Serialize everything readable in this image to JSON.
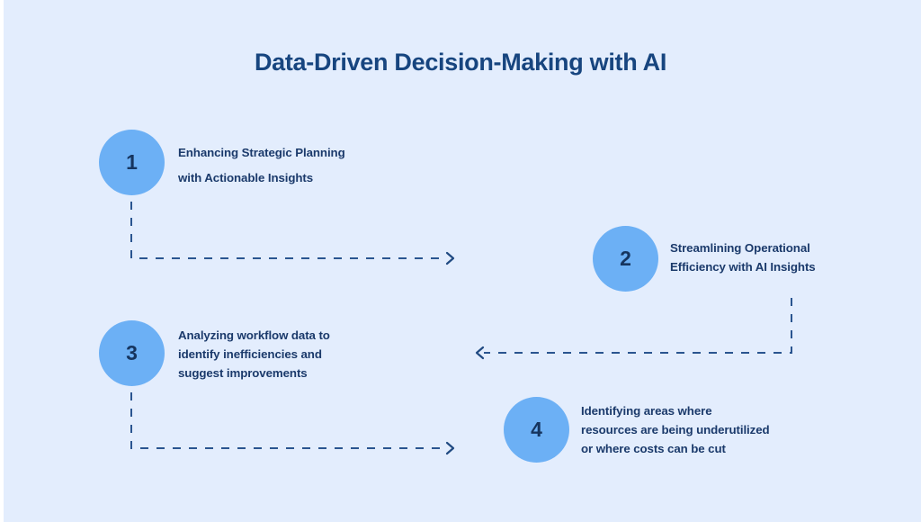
{
  "page": {
    "title": "Data-Driven Decision-Making with AI",
    "background_color": "#e3edfd",
    "title_color": "#17457f",
    "circle_color": "#6cb0f5",
    "text_color": "#1b3a6b",
    "connector_color": "#2a5590"
  },
  "steps": [
    {
      "number": "1",
      "lines": [
        "Enhancing Strategic Planning",
        "with Actionable Insights"
      ]
    },
    {
      "number": "2",
      "lines": [
        "Streamlining Operational",
        "Efficiency with AI Insights"
      ]
    },
    {
      "number": "3",
      "lines": [
        "Analyzing workflow data to",
        "identify inefficiencies and",
        "suggest improvements"
      ]
    },
    {
      "number": "4",
      "lines": [
        " Identifying areas where",
        "resources are being underutilized",
        "or where costs can be cut"
      ]
    }
  ],
  "connectors": [
    {
      "name": "step-1-to-step-2",
      "direction": "right"
    },
    {
      "name": "step-2-to-step-3",
      "direction": "left"
    },
    {
      "name": "step-3-to-step-4",
      "direction": "right"
    }
  ]
}
